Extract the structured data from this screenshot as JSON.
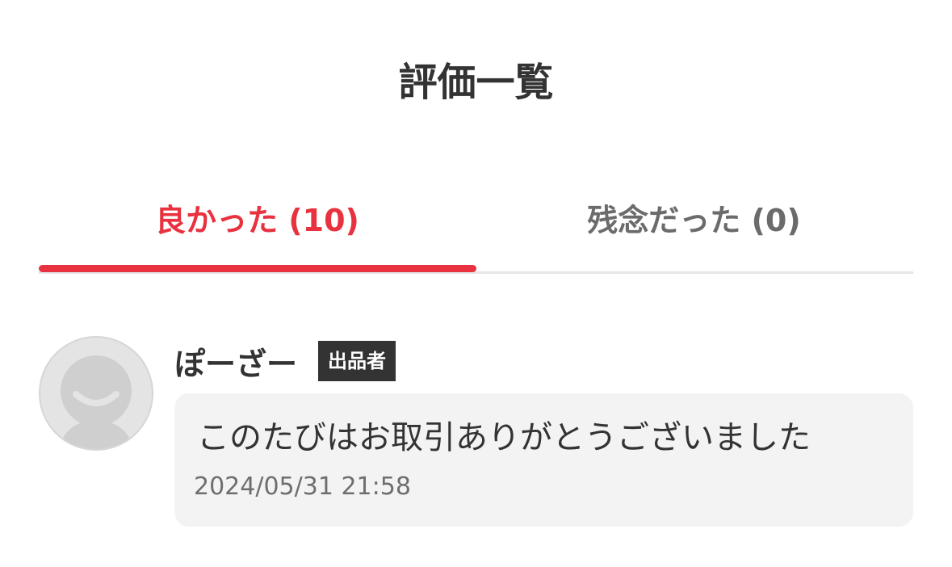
{
  "header": {
    "title": "評価一覧"
  },
  "tabs": [
    {
      "label": "良かった (10)",
      "active": true
    },
    {
      "label": "残念だった (0)",
      "active": false
    }
  ],
  "review": {
    "user_name": "ぽーざー",
    "badge": "出品者",
    "avatar_icon": "default-user-avatar-icon",
    "comment": "このたびはお取引ありがとうございました",
    "timestamp": "2024/05/31 21:58"
  },
  "colors": {
    "accent": "#e8323f",
    "text": "#333333",
    "muted": "#6b6b6b",
    "bubble": "#f3f3f3"
  }
}
